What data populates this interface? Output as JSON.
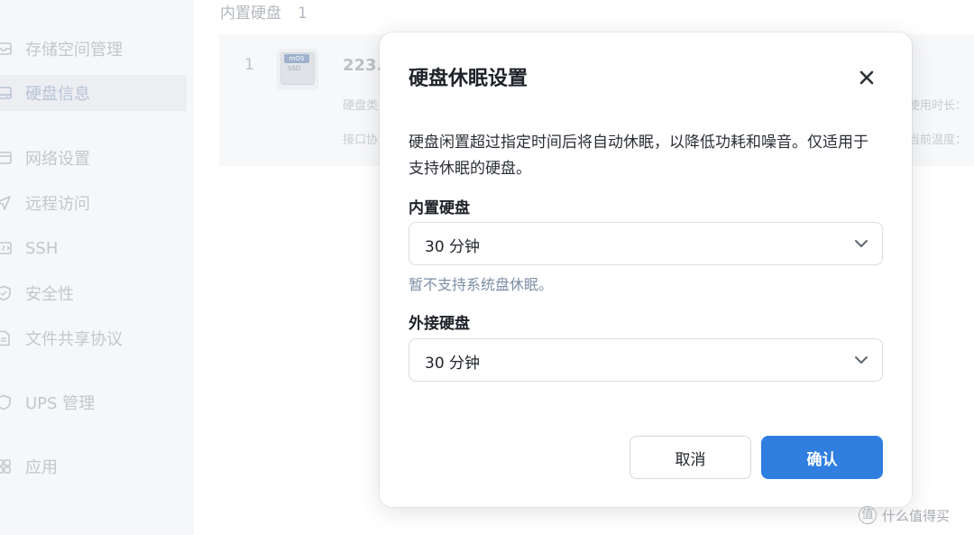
{
  "background": {
    "section": {
      "title": "内置硬盘",
      "count": "1"
    },
    "sidebar": {
      "items": [
        {
          "label": "存储空间管理",
          "icon": "storage-icon",
          "active": false
        },
        {
          "label": "硬盘信息",
          "icon": "disk-icon",
          "active": true
        },
        {
          "label": "网络设置",
          "icon": "network-icon",
          "active": false
        },
        {
          "label": "远程访问",
          "icon": "send-icon",
          "active": false
        },
        {
          "label": "SSH",
          "icon": "terminal-icon",
          "active": false
        },
        {
          "label": "安全性",
          "icon": "shield-icon",
          "active": false
        },
        {
          "label": "文件共享协议",
          "icon": "file-icon",
          "active": false
        },
        {
          "label": "UPS 管理",
          "icon": "ups-shield-icon",
          "active": false
        },
        {
          "label": "应用",
          "icon": "apps-icon",
          "active": false
        }
      ]
    },
    "disk": {
      "index": "1",
      "name": "223.",
      "thumb_tag": "mOS",
      "thumb_text": "SSD",
      "meta_left_1": "硬盘类",
      "meta_left_2": "接口协",
      "meta_right_1": "使用时长：",
      "meta_right_2": "当前温度："
    }
  },
  "modal": {
    "title": "硬盘休眠设置",
    "description": "硬盘闲置超过指定时间后将自动休眠，以降低功耗和噪音。仅适用于支持休眠的硬盘。",
    "internal": {
      "label": "内置硬盘",
      "value": "30 分钟",
      "hint": "暂不支持系统盘休眠。"
    },
    "external": {
      "label": "外接硬盘",
      "value": "30 分钟"
    },
    "cancel_label": "取消",
    "confirm_label": "确认"
  },
  "watermark": {
    "logo": "值",
    "text": "什么值得买"
  },
  "colors": {
    "primary": "#2f7ee0",
    "hint": "#7d8ea5",
    "sidebar_bg": "#f6f7f9"
  }
}
